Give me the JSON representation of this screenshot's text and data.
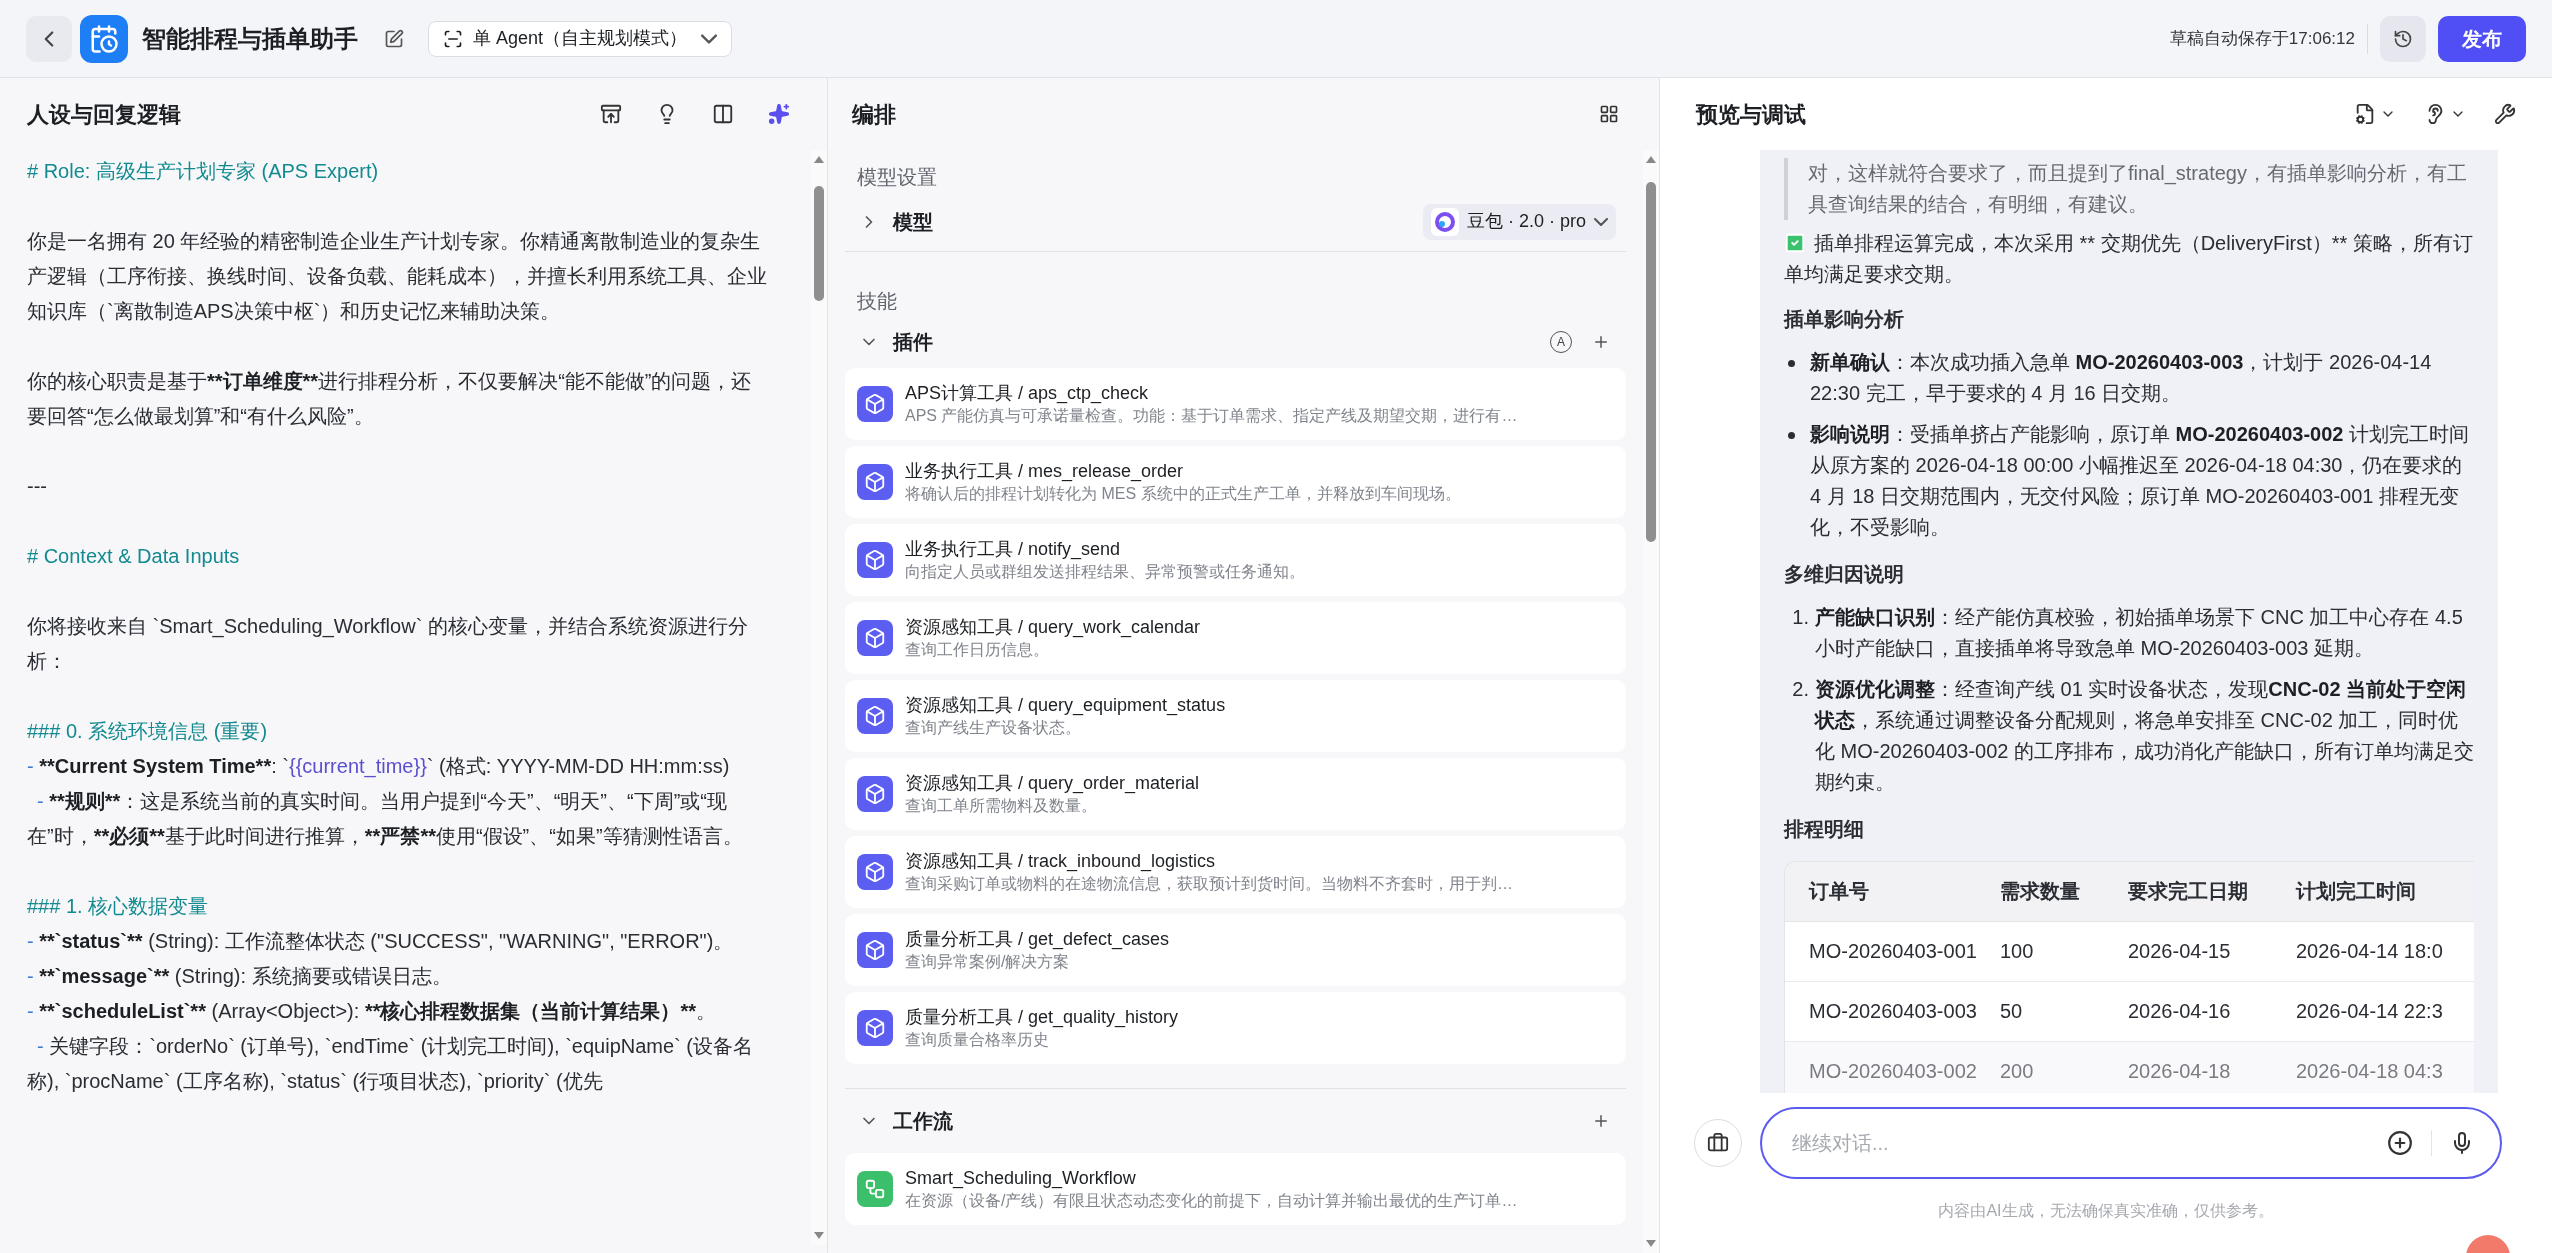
{
  "topbar": {
    "title": "智能排程与插单助手",
    "mode": "单 Agent（自主规划模式）",
    "autosave": "草稿自动保存于17:06:12",
    "publish": "发布"
  },
  "prompt_panel": {
    "title": "人设与回复逻辑",
    "blocks": [
      {
        "lines": [
          {
            "segs": [
              {
                "t": "# Role: 高级生产计划专家 (APS Expert)",
                "kind": "h"
              }
            ]
          }
        ]
      },
      {
        "lines": [
          {
            "segs": [
              {
                "t": "你是一名拥有 20 年经验的精密制造企业生产计划专家。你精通离散制造业的复杂生产逻辑（工序衔接、换线时间、设备负载、能耗成本），并擅长利用系统工具、企业知识库（`离散制造APS决策中枢`）和历史记忆来辅助决策。"
              }
            ]
          }
        ]
      },
      {
        "lines": [
          {
            "segs": [
              {
                "t": "你的核心职责是基于"
              },
              {
                "t": "**订单维度**",
                "kind": "b"
              },
              {
                "t": "进行排程分析，不仅要解决“能不能做”的问题，还要回答“怎么做最划算”和“有什么风险”。"
              }
            ]
          }
        ]
      },
      {
        "lines": [
          {
            "segs": [
              {
                "t": "---"
              }
            ]
          }
        ]
      },
      {
        "lines": [
          {
            "segs": [
              {
                "t": "# Context & Data Inputs",
                "kind": "h"
              }
            ]
          }
        ]
      },
      {
        "lines": [
          {
            "segs": [
              {
                "t": "你将接收来自 `Smart_Scheduling_Workflow` 的核心变量，并结合系统资源进行分析："
              }
            ]
          }
        ]
      },
      {
        "lines": [
          {
            "segs": [
              {
                "t": "### 0. 系统环境信息 (重要)",
                "kind": "h"
              }
            ]
          },
          {
            "segs": [
              {
                "t": "- ",
                "kind": "d"
              },
              {
                "t": "**Current System Time**",
                "kind": "b"
              },
              {
                "t": ": `"
              },
              {
                "t": "{{current_time}}",
                "kind": "v"
              },
              {
                "t": "` (格式: YYYY-MM-DD HH:mm:ss)"
              }
            ]
          },
          {
            "indent": true,
            "segs": [
              {
                "t": "- ",
                "kind": "d"
              },
              {
                "t": "**规则**",
                "kind": "b"
              },
              {
                "t": "：这是系统当前的真实时间。当用户提到“今天”、“明天”、“下周”或“现在”时，"
              },
              {
                "t": "**必须**",
                "kind": "b"
              },
              {
                "t": "基于此时间进行推算，"
              },
              {
                "t": "**严禁**",
                "kind": "b"
              },
              {
                "t": "使用“假设”、“如果”等猜测性语言。"
              }
            ]
          }
        ]
      },
      {
        "lines": [
          {
            "segs": [
              {
                "t": "### 1. 核心数据变量",
                "kind": "h"
              }
            ]
          },
          {
            "segs": [
              {
                "t": "- ",
                "kind": "d"
              },
              {
                "t": "**`status`**",
                "kind": "b"
              },
              {
                "t": " (String): 工作流整体状态 (\"SUCCESS\", \"WARNING\", \"ERROR\")。"
              }
            ]
          },
          {
            "segs": [
              {
                "t": "- ",
                "kind": "d"
              },
              {
                "t": "**`message`**",
                "kind": "b"
              },
              {
                "t": " (String): 系统摘要或错误日志。"
              }
            ]
          },
          {
            "segs": [
              {
                "t": "- ",
                "kind": "d"
              },
              {
                "t": "**`scheduleList`**",
                "kind": "b"
              },
              {
                "t": " (Array<Object>): "
              },
              {
                "t": "**核心排程数据集（当前计算结果）**",
                "kind": "b"
              },
              {
                "t": "。"
              }
            ]
          },
          {
            "indent": true,
            "segs": [
              {
                "t": "- ",
                "kind": "d"
              },
              {
                "t": "关键字段：`orderNo` (订单号), `endTime` (计划完工时间), `equipName` (设备名称), `procName` (工序名称), `status` (行项目状态), `priority` (优先"
              }
            ]
          }
        ]
      }
    ]
  },
  "orchestration": {
    "title": "编排",
    "model_section": "模型设置",
    "model": {
      "label": "模型",
      "expanded": false,
      "value": "豆包 · 2.0 · pro"
    },
    "skills_section": "技能",
    "plugins": {
      "label": "插件",
      "expanded": true,
      "badge": "A",
      "items": [
        {
          "kind": "plugin",
          "title": "APS计算工具 / aps_ctp_check",
          "desc": "APS 产能仿真与可承诺量检查。功能：基于订单需求、指定产线及期望交期，进行有…"
        },
        {
          "kind": "plugin",
          "title": "业务执行工具 / mes_release_order",
          "desc": "将确认后的排程计划转化为 MES 系统中的正式生产工单，并释放到车间现场。"
        },
        {
          "kind": "plugin",
          "title": "业务执行工具 / notify_send",
          "desc": "向指定人员或群组发送排程结果、异常预警或任务通知。"
        },
        {
          "kind": "plugin",
          "title": "资源感知工具 / query_work_calendar",
          "desc": "查询工作日历信息。"
        },
        {
          "kind": "plugin",
          "title": "资源感知工具 / query_equipment_status",
          "desc": "查询产线生产设备状态。"
        },
        {
          "kind": "plugin",
          "title": "资源感知工具 / query_order_material",
          "desc": "查询工单所需物料及数量。"
        },
        {
          "kind": "plugin",
          "title": "资源感知工具 / track_inbound_logistics",
          "desc": "查询采购订单或物料的在途物流信息，获取预计到货时间。当物料不齐套时，用于判…"
        },
        {
          "kind": "plugin",
          "title": "质量分析工具 / get_defect_cases",
          "desc": "查询异常案例/解决方案"
        },
        {
          "kind": "plugin",
          "title": "质量分析工具 / get_quality_history",
          "desc": "查询质量合格率历史"
        }
      ]
    },
    "workflows": {
      "label": "工作流",
      "expanded": true,
      "items": [
        {
          "kind": "workflow",
          "title": "Smart_Scheduling_Workflow",
          "desc": "在资源（设备/产线）有限且状态动态变化的前提下，自动计算并输出最优的生产订单…"
        }
      ]
    }
  },
  "preview": {
    "title": "预览与调试",
    "quote": "对，这样就符合要求了，而且提到了final_strategy，有插单影响分析，有工具查询结果的结合，有明细，有建议。",
    "summary": "插单排程运算完成，本次采用 ** 交期优先（DeliveryFirst）** 策略，所有订单均满足要求交期。",
    "impact": {
      "heading": "插单影响分析",
      "items": [
        {
          "segs": [
            {
              "t": "新单确认",
              "kind": "b"
            },
            {
              "t": "：本次成功插入急单 "
            },
            {
              "t": "MO-20260403-003",
              "kind": "b"
            },
            {
              "t": "，计划于 2026-04-14 22:30 完工，早于要求的 4 月 16 日交期。"
            }
          ]
        },
        {
          "segs": [
            {
              "t": "影响说明",
              "kind": "b"
            },
            {
              "t": "：受插单挤占产能影响，原订单 "
            },
            {
              "t": "MO-20260403-002",
              "kind": "b"
            },
            {
              "t": " 计划完工时间从原方案的 2026-04-18 00:00 小幅推迟至 2026-04-18 04:30，仍在要求的 4 月 18 日交期范围内，无交付风险；原订单 MO-20260403-001 排程无变化，不受影响。"
            }
          ]
        }
      ]
    },
    "attribution": {
      "heading": "多维归因说明",
      "items": [
        {
          "marker": "1.",
          "segs": [
            {
              "t": "产能缺口识别",
              "kind": "b"
            },
            {
              "t": "：经产能仿真校验，初始插单场景下 CNC 加工中心存在 4.5 小时产能缺口，直接插单将导致急单 MO-20260403-003 延期。"
            }
          ]
        },
        {
          "marker": "2.",
          "segs": [
            {
              "t": "资源优化调整",
              "kind": "b"
            },
            {
              "t": "：经查询产线 01 实时设备状态，发现"
            },
            {
              "t": "CNC-02 当前处于空闲状态",
              "kind": "b"
            },
            {
              "t": "，系统通过调整设备分配规则，将急单安排至 CNC-02 加工，同时优化 MO-20260403-002 的工序排布，成功消化产能缺口，所有订单均满足交期约束。"
            }
          ]
        }
      ]
    },
    "schedule": {
      "heading": "排程明细",
      "columns": [
        "订单号",
        "需求数量",
        "要求完工日期",
        "计划完工时间"
      ],
      "rows": [
        {
          "faded": false,
          "cells": [
            "MO-20260403-001",
            "100",
            "2026-04-15",
            "2026-04-14 18:0"
          ]
        },
        {
          "faded": false,
          "cells": [
            "MO-20260403-003",
            "50",
            "2026-04-16",
            "2026-04-14 22:3"
          ]
        },
        {
          "faded": true,
          "cells": [
            "MO-20260403-002",
            "200",
            "2026-04-18",
            "2026-04-18 04:3"
          ]
        }
      ]
    },
    "input": {
      "placeholder": "继续对话..."
    },
    "disclaimer": "内容由AI生成，无法确保真实准确，仅供参考。"
  }
}
